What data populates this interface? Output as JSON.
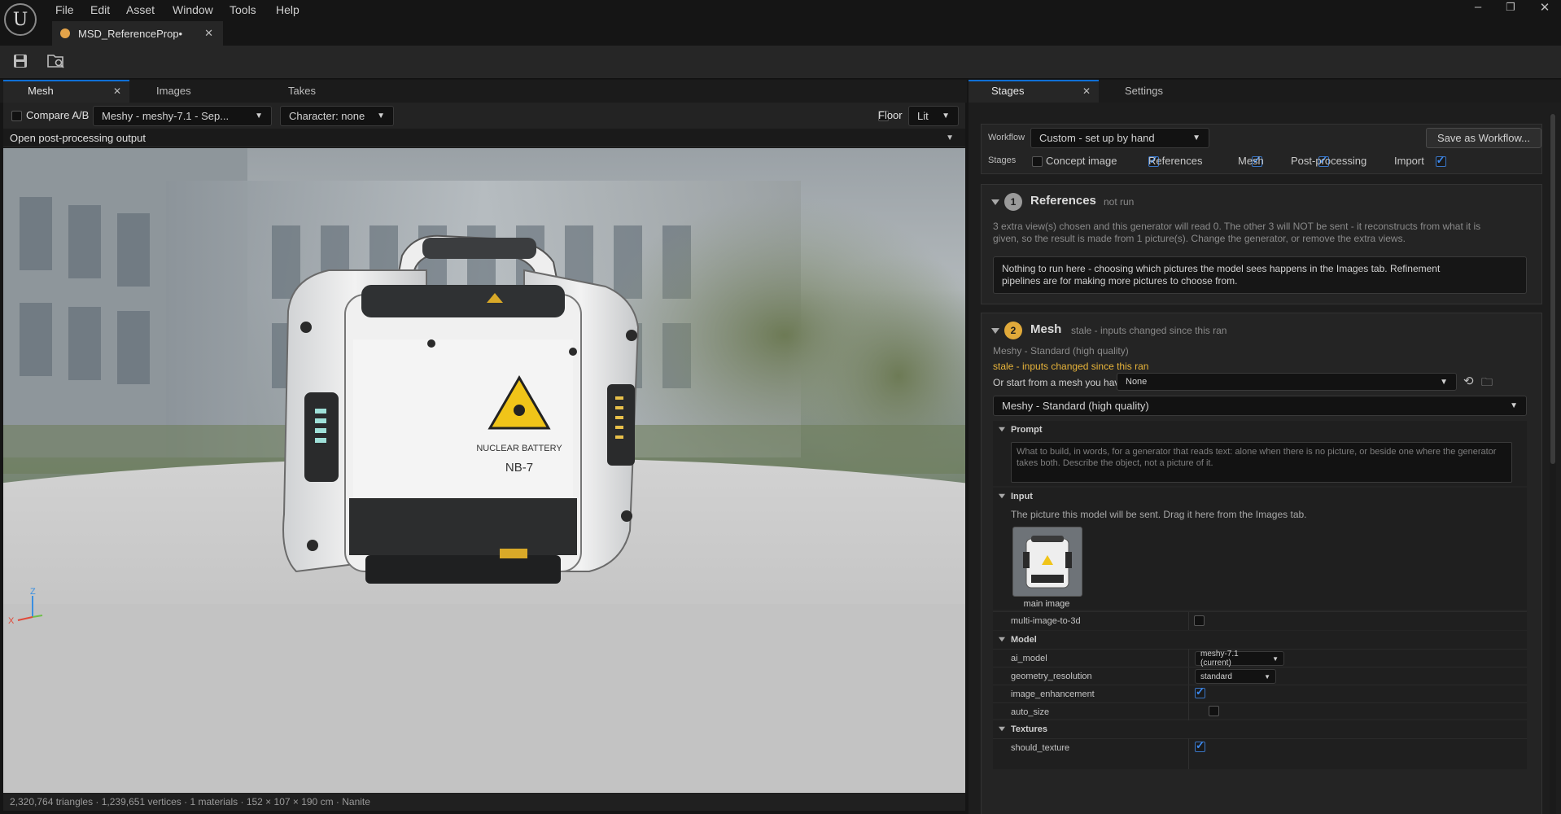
{
  "app": {
    "menu": [
      "File",
      "Edit",
      "Asset",
      "Window",
      "Tools",
      "Help"
    ],
    "doc_tab": "MSD_ReferenceProp•",
    "logo_glyph": "U"
  },
  "left_panel": {
    "tabs": [
      "Mesh",
      "Images",
      "Takes"
    ],
    "compare_label": "Compare A/B",
    "model_dropdown": "Meshy - meshy-7.1 - Sep...",
    "character_dropdown": "Character: none",
    "floor_label": "Floor",
    "lit_dropdown": "Lit",
    "pp_output": "Open post-processing output",
    "prop_label_line1": "NUCLEAR BATTERY",
    "prop_label_line2": "NB-7",
    "axis_z": "Z",
    "axis_x": "X",
    "status": "2,320,764 triangles · 1,239,651 vertices · 1 materials · 152 × 107 × 190 cm · Nanite"
  },
  "right_panel": {
    "tabs": [
      "Stages",
      "Settings"
    ],
    "workflow_label": "Workflow",
    "workflow_value": "Custom - set up by hand",
    "save_workflow": "Save as Workflow...",
    "stages_label": "Stages",
    "stages": [
      {
        "label": "Concept image",
        "checked": false
      },
      {
        "label": "References",
        "checked": true
      },
      {
        "label": "Mesh",
        "checked": true
      },
      {
        "label": "Post-processing",
        "checked": true
      },
      {
        "label": "Import",
        "checked": true
      }
    ],
    "references": {
      "number": "1",
      "title": "References",
      "status": "not run",
      "desc_line1": "3 extra view(s) chosen and this generator will read 0. The other 3 will NOT be sent - it reconstructs from what it is",
      "desc_line2": "given, so the result is made from 1 picture(s). Change the generator, or remove the extra views.",
      "note_line1": "Nothing to run here - choosing which pictures the model sees happens in the Images tab. Refinement",
      "note_line2": "pipelines are for making more pictures to choose from."
    },
    "mesh": {
      "number": "2",
      "title": "Mesh",
      "status": "stale - inputs changed since this ran",
      "generator": "Meshy - Standard (high quality)",
      "stale_text": "stale - inputs changed since this ran",
      "start_label": "Or start from a mesh you have:",
      "start_value": "None",
      "generator_dropdown": "Meshy - Standard (high quality)",
      "prompt_header": "Prompt",
      "prompt_placeholder": "What to build, in words, for a generator that reads text: alone when there is no picture, or beside one where the generator takes both. Describe the object, not a picture of it.",
      "input_header": "Input",
      "input_desc": "The picture this model will be sent. Drag it here from the Images tab.",
      "thumb_caption": "main image",
      "multi_image": "multi-image-to-3d",
      "model_header": "Model",
      "ai_model_label": "ai_model",
      "ai_model_value": "meshy-7.1 (current)",
      "geometry_label": "geometry_resolution",
      "geometry_value": "standard",
      "image_enh_label": "image_enhancement",
      "auto_size_label": "auto_size",
      "textures_header": "Textures",
      "should_texture_label": "should_texture"
    }
  },
  "colors": {
    "accent_blue": "#0f6fd6",
    "stale_yellow": "#e8b43a",
    "badge_grey": "#9a9a9a",
    "badge_yellow": "#e0a93a"
  }
}
